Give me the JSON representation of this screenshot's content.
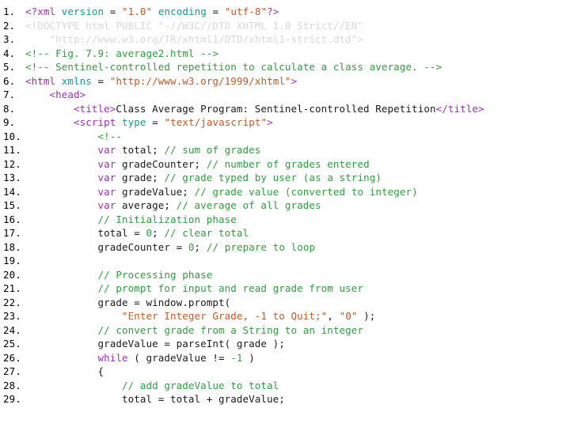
{
  "document": {
    "title": "Class Average Program: Sentinel-controlled Repetition",
    "figure": "Fig. 7.9: average2.html",
    "language": "XHTML + JavaScript",
    "background_color": "#ffffff",
    "token_colors": {
      "tag": "#9b30b0",
      "attribute": "#159a8c",
      "string": "#c05a2a",
      "comment": "#2f9c3f",
      "keyword": "#9b30b0",
      "number": "#2f9c3f",
      "plain": "#1a1a1a",
      "faded": "#d8d8d8",
      "line_number": "#000000"
    }
  },
  "lines": [
    {
      "num": "1.",
      "tokens": [
        {
          "t": "<?xml ",
          "c": "tag"
        },
        {
          "t": "version",
          "c": "attr"
        },
        {
          "t": " = ",
          "c": "op"
        },
        {
          "t": "\"1.0\"",
          "c": "string"
        },
        {
          "t": " ",
          "c": "plain"
        },
        {
          "t": "encoding",
          "c": "attr"
        },
        {
          "t": " = ",
          "c": "op"
        },
        {
          "t": "\"utf-8\"",
          "c": "string"
        },
        {
          "t": "?>",
          "c": "tag"
        }
      ]
    },
    {
      "num": "2.",
      "tokens": [
        {
          "t": "<!DOCTYPE html PUBLIC \"-//W3C//DTD XHTML 1.0 Strict//EN\"",
          "c": "faded"
        }
      ]
    },
    {
      "num": "3.",
      "tokens": [
        {
          "t": "    \"http://www.w3.org/TR/xhtml1/DTD/xhtml1-strict.dtd\">",
          "c": "faded"
        }
      ]
    },
    {
      "num": "4.",
      "tokens": [
        {
          "t": "<!-- Fig. 7.9: average2.html -->",
          "c": "comment"
        }
      ]
    },
    {
      "num": "5.",
      "tokens": [
        {
          "t": "<!-- Sentinel-controlled repetition to calculate a class average. -->",
          "c": "comment"
        }
      ]
    },
    {
      "num": "6.",
      "tokens": [
        {
          "t": "<html ",
          "c": "tag"
        },
        {
          "t": "xmlns",
          "c": "attr"
        },
        {
          "t": " = ",
          "c": "op"
        },
        {
          "t": "\"http://www.w3.org/1999/xhtml\"",
          "c": "string"
        },
        {
          "t": ">",
          "c": "tag"
        }
      ]
    },
    {
      "num": "7.",
      "tokens": [
        {
          "t": "    ",
          "c": "plain"
        },
        {
          "t": "<head>",
          "c": "tag"
        }
      ]
    },
    {
      "num": "8.",
      "tokens": [
        {
          "t": "        ",
          "c": "plain"
        },
        {
          "t": "<title>",
          "c": "tag"
        },
        {
          "t": "Class Average Program: Sentinel-controlled Repetition",
          "c": "plain"
        },
        {
          "t": "</title>",
          "c": "tag"
        }
      ]
    },
    {
      "num": "9.",
      "tokens": [
        {
          "t": "        ",
          "c": "plain"
        },
        {
          "t": "<script ",
          "c": "tag"
        },
        {
          "t": "type",
          "c": "attr"
        },
        {
          "t": " = ",
          "c": "op"
        },
        {
          "t": "\"text/javascript\"",
          "c": "string"
        },
        {
          "t": ">",
          "c": "tag"
        }
      ]
    },
    {
      "num": "10.",
      "tokens": [
        {
          "t": "            ",
          "c": "plain"
        },
        {
          "t": "<!--",
          "c": "comment"
        }
      ]
    },
    {
      "num": "11.",
      "tokens": [
        {
          "t": "            ",
          "c": "plain"
        },
        {
          "t": "var",
          "c": "keyword"
        },
        {
          "t": " total; ",
          "c": "plain"
        },
        {
          "t": "// sum of grades",
          "c": "comment"
        }
      ]
    },
    {
      "num": "12.",
      "tokens": [
        {
          "t": "            ",
          "c": "plain"
        },
        {
          "t": "var",
          "c": "keyword"
        },
        {
          "t": " gradeCounter; ",
          "c": "plain"
        },
        {
          "t": "// number of grades entered",
          "c": "comment"
        }
      ]
    },
    {
      "num": "13.",
      "tokens": [
        {
          "t": "            ",
          "c": "plain"
        },
        {
          "t": "var",
          "c": "keyword"
        },
        {
          "t": " grade; ",
          "c": "plain"
        },
        {
          "t": "// grade typed by user (as a string)",
          "c": "comment"
        }
      ]
    },
    {
      "num": "14.",
      "tokens": [
        {
          "t": "            ",
          "c": "plain"
        },
        {
          "t": "var",
          "c": "keyword"
        },
        {
          "t": " gradeValue; ",
          "c": "plain"
        },
        {
          "t": "// grade value (converted to integer)",
          "c": "comment"
        }
      ]
    },
    {
      "num": "15.",
      "tokens": [
        {
          "t": "            ",
          "c": "plain"
        },
        {
          "t": "var",
          "c": "keyword"
        },
        {
          "t": " average; ",
          "c": "plain"
        },
        {
          "t": "// average of all grades",
          "c": "comment"
        }
      ]
    },
    {
      "num": "16.",
      "tokens": [
        {
          "t": "            ",
          "c": "plain"
        },
        {
          "t": "// Initialization phase",
          "c": "comment"
        }
      ]
    },
    {
      "num": "17.",
      "tokens": [
        {
          "t": "            total = ",
          "c": "plain"
        },
        {
          "t": "0",
          "c": "number"
        },
        {
          "t": "; ",
          "c": "plain"
        },
        {
          "t": "// clear total",
          "c": "comment"
        }
      ]
    },
    {
      "num": "18.",
      "tokens": [
        {
          "t": "            gradeCounter = ",
          "c": "plain"
        },
        {
          "t": "0",
          "c": "number"
        },
        {
          "t": "; ",
          "c": "plain"
        },
        {
          "t": "// prepare to loop",
          "c": "comment"
        }
      ]
    },
    {
      "num": "19.",
      "tokens": [
        {
          "t": "",
          "c": "plain"
        }
      ]
    },
    {
      "num": "20.",
      "tokens": [
        {
          "t": "            ",
          "c": "plain"
        },
        {
          "t": "// Processing phase",
          "c": "comment"
        }
      ]
    },
    {
      "num": "21.",
      "tokens": [
        {
          "t": "            ",
          "c": "plain"
        },
        {
          "t": "// prompt for input and read grade from user",
          "c": "comment"
        }
      ]
    },
    {
      "num": "22.",
      "tokens": [
        {
          "t": "            grade = window.prompt(",
          "c": "plain"
        }
      ]
    },
    {
      "num": "23.",
      "tokens": [
        {
          "t": "                ",
          "c": "plain"
        },
        {
          "t": "\"Enter Integer Grade, -1 to Quit;\"",
          "c": "string"
        },
        {
          "t": ", ",
          "c": "plain"
        },
        {
          "t": "\"0\"",
          "c": "string"
        },
        {
          "t": " );",
          "c": "plain"
        }
      ]
    },
    {
      "num": "24.",
      "tokens": [
        {
          "t": "            ",
          "c": "plain"
        },
        {
          "t": "// convert grade from a String to an integer",
          "c": "comment"
        }
      ]
    },
    {
      "num": "25.",
      "tokens": [
        {
          "t": "            gradeValue = parseInt( grade );",
          "c": "plain"
        }
      ]
    },
    {
      "num": "26.",
      "tokens": [
        {
          "t": "            ",
          "c": "plain"
        },
        {
          "t": "while",
          "c": "keyword"
        },
        {
          "t": " ( gradeValue != ",
          "c": "plain"
        },
        {
          "t": "-1",
          "c": "number"
        },
        {
          "t": " )",
          "c": "plain"
        }
      ]
    },
    {
      "num": "27.",
      "tokens": [
        {
          "t": "            {",
          "c": "plain"
        }
      ]
    },
    {
      "num": "28.",
      "tokens": [
        {
          "t": "                ",
          "c": "plain"
        },
        {
          "t": "// add gradeValue to total",
          "c": "comment"
        }
      ]
    },
    {
      "num": "29.",
      "tokens": [
        {
          "t": "                total = total + gradeValue;",
          "c": "plain"
        }
      ]
    }
  ]
}
